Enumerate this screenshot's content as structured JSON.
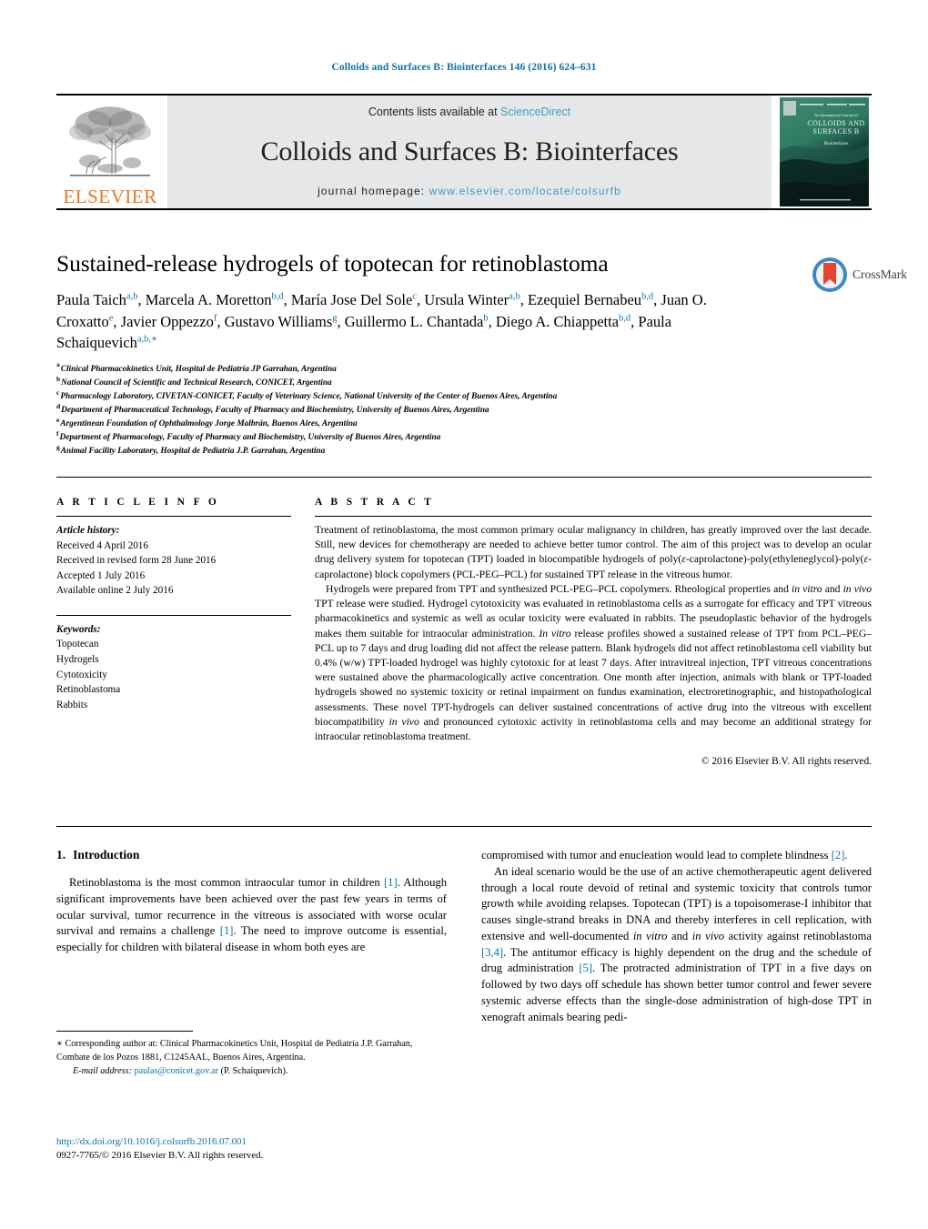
{
  "running_head": "Colloids and Surfaces B: Biointerfaces 146 (2016) 624–631",
  "masthead": {
    "publisher_logo_name": "elsevier-tree-logo",
    "publisher_wordmark": "ELSEVIER",
    "contents_prefix": "Contents lists available at ",
    "contents_link": "ScienceDirect",
    "journal_title": "Colloids and Surfaces B: Biointerfaces",
    "homepage_prefix": "journal homepage: ",
    "homepage_url": "www.elsevier.com/locate/colsurfb",
    "cover_thumbnail_name": "journal-cover-thumbnail",
    "cover_line1": "An International Journal of",
    "cover_line2": "COLLOIDS AND",
    "cover_line3": "SURFACES B",
    "cover_line4": "Biointerfaces"
  },
  "article": {
    "title": "Sustained-release hydrogels of topotecan for retinoblastoma",
    "crossmark_label": "CrossMark",
    "authors": [
      {
        "name": "Paula Taich",
        "sup": "a,b",
        "sep": ", "
      },
      {
        "name": "Marcela A. Moretton",
        "sup": "b,d",
        "sep": ", "
      },
      {
        "name": "María Jose Del Sole",
        "sup": "c",
        "sep": ", "
      },
      {
        "name": "Ursula Winter",
        "sup": "a,b",
        "sep": ", "
      },
      {
        "name": "Ezequiel Bernabeu",
        "sup": "b,d",
        "sep": ", "
      },
      {
        "name": "Juan O. Croxatto",
        "sup": "e",
        "sep": ", "
      },
      {
        "name": "Javier Oppezzo",
        "sup": "f",
        "sep": ", "
      },
      {
        "name": "Gustavo Williams",
        "sup": "g",
        "sep": ", "
      },
      {
        "name": "Guillermo L. Chantada",
        "sup": "b",
        "sep": ", "
      },
      {
        "name": "Diego A. Chiappetta",
        "sup": "b,d",
        "sep": ", "
      },
      {
        "name": "Paula Schaiquevich",
        "sup": "a,b,∗",
        "sep": ""
      }
    ],
    "affiliations": [
      {
        "mark": "a",
        "text": "Clinical Pharmacokinetics Unit, Hospital de Pediatría JP Garrahan, Argentina"
      },
      {
        "mark": "b",
        "text": "National Council of Scientific and Technical Research, CONICET, Argentina"
      },
      {
        "mark": "c",
        "text": "Pharmacology Laboratory, CIVETAN-CONICET, Faculty of Veterinary Science, National University of the Center of Buenos Aires, Argentina"
      },
      {
        "mark": "d",
        "text": "Department of Pharmaceutical Technology, Faculty of Pharmacy and Biochemistry, University of Buenos Aires, Argentina"
      },
      {
        "mark": "e",
        "text": "Argentinean Foundation of Ophthalmology Jorge Malbrán, Buenos Aires, Argentina"
      },
      {
        "mark": "f",
        "text": "Department of Pharmacology, Faculty of Pharmacy and Biochemistry, University of Buenos Aires, Argentina"
      },
      {
        "mark": "g",
        "text": "Animal Facility Laboratory, Hospital de Pediatria J.P. Garrahan, Argentina"
      }
    ]
  },
  "article_info": {
    "heading": "A R T I C L E   I N F O",
    "history_label": "Article history:",
    "history": [
      "Received 4 April 2016",
      "Received in revised form 28 June 2016",
      "Accepted 1 July 2016",
      "Available online 2 July 2016"
    ],
    "keywords_label": "Keywords:",
    "keywords": [
      "Topotecan",
      "Hydrogels",
      "Cytotoxicity",
      "Retinoblastoma",
      "Rabbits"
    ]
  },
  "abstract": {
    "heading": "A B S T R A C T",
    "paragraph1_a": "Treatment of retinoblastoma, the most common primary ocular malignancy in children, has greatly improved over the last decade. Still, new devices for chemotherapy are needed to achieve better tumor control. The aim of this project was to develop an ocular drug delivery system for topotecan (TPT) loaded in biocompatible hydrogels of poly(",
    "paragraph1_eps1": "ε",
    "paragraph1_b": "-caprolactone)-poly(ethyleneglycol)-poly(",
    "paragraph1_eps2": "ε",
    "paragraph1_c": "-caprolactone) block copolymers (PCL-PEG–PCL) for sustained TPT release in the vitreous humor.",
    "paragraph2_a": "Hydrogels were prepared from TPT and synthesized PCL-PEG–PCL copolymers. Rheological properties and ",
    "p2_it1": "in vitro",
    "paragraph2_b": " and ",
    "p2_it2": "in vivo",
    "paragraph2_c": " TPT release were studied. Hydrogel cytotoxicity was evaluated in retinoblastoma cells as a surrogate for efficacy and TPT vitreous pharmacokinetics and systemic as well as ocular toxicity were evaluated in rabbits. The pseudoplastic behavior of the hydrogels makes them suitable for intraocular administration. ",
    "p2_it3": "In vitro",
    "paragraph2_d": " release profiles showed a sustained release of TPT from PCL–PEG–PCL up to 7 days and drug loading did not affect the release pattern. Blank hydrogels did not affect retinoblastoma cell viability but 0.4% (w/w) TPT-loaded hydrogel was highly cytotoxic for at least 7 days. After intravitreal injection, TPT vitreous concentrations were sustained above the pharmacologically active concentration. One month after injection, animals with blank or TPT-loaded hydrogels showed no systemic toxicity or retinal impairment on fundus examination, electroretinographic, and histopathological assessments. These novel TPT-hydrogels can deliver sustained concentrations of active drug into the vitreous with excellent biocompatibility ",
    "p2_it4": "in vivo",
    "paragraph2_e": " and pronounced cytotoxic activity in retinoblastoma cells and may become an additional strategy for intraocular retinoblastoma treatment.",
    "copyright": "© 2016 Elsevier B.V. All rights reserved."
  },
  "introduction": {
    "number": "1.",
    "heading": "Introduction",
    "left_p1_a": "Retinoblastoma is the most common intraocular tumor in children ",
    "left_ref1": "[1]",
    "left_p1_b": ". Although significant improvements have been achieved over the past few years in terms of ocular survival, tumor recurrence in the vitreous is associated with worse ocular survival and remains a challenge ",
    "left_ref2": "[1]",
    "left_p1_c": ". The need to improve outcome is essential, especially for children with bilateral disease in whom both eyes are",
    "right_p1_a": "compromised with tumor and enucleation would lead to complete blindness ",
    "right_ref1": "[2]",
    "right_p1_b": ".",
    "right_p2_a": "An ideal scenario would be the use of an active chemotherapeutic agent delivered through a local route devoid of retinal and systemic toxicity that controls tumor growth while avoiding relapses. Topotecan (TPT) is a topoisomerase-I inhibitor that causes single-strand breaks in DNA and thereby interferes in cell replication, with extensive and well-documented ",
    "r_it1": "in vitro",
    "right_p2_b": " and ",
    "r_it2": "in vivo",
    "right_p2_c": " activity against retinoblastoma ",
    "right_ref2": "[3,4]",
    "right_p2_d": ". The antitumor efficacy is highly dependent on the drug and the schedule of drug administration ",
    "right_ref3": "[5]",
    "right_p2_e": ". The protracted administration of TPT in a five days on followed by two days off schedule has shown better tumor control and fewer severe systemic adverse effects than the single-dose administration of high-dose TPT in xenograft animals bearing pedi-"
  },
  "footnote": {
    "star": "∗",
    "line1": " Corresponding author at: Clinical Pharmacokinetics Unit, Hospital de Pediatría",
    "line2": "J.P. Garrahan, Combate de los Pozos 1881, C1245AAL, Buenos Aires, Argentina.",
    "email_label": "E-mail address:",
    "email": "paulas@conicet.gov.ar",
    "email_suffix": " (P. Schaiquevich)."
  },
  "bottom": {
    "doi": "http://dx.doi.org/10.1016/j.colsurfb.2016.07.001",
    "issn": "0927-7765/© 2016 Elsevier B.V. All rights reserved."
  },
  "colors": {
    "link_blue": "#0b72a8",
    "sciencedirect_blue": "#3f9bc9",
    "elsevier_orange": "#E87722",
    "masthead_grey": "#e6e7e8",
    "crossmark_red": "#e8442f",
    "crossmark_blue": "#3c87c8"
  }
}
